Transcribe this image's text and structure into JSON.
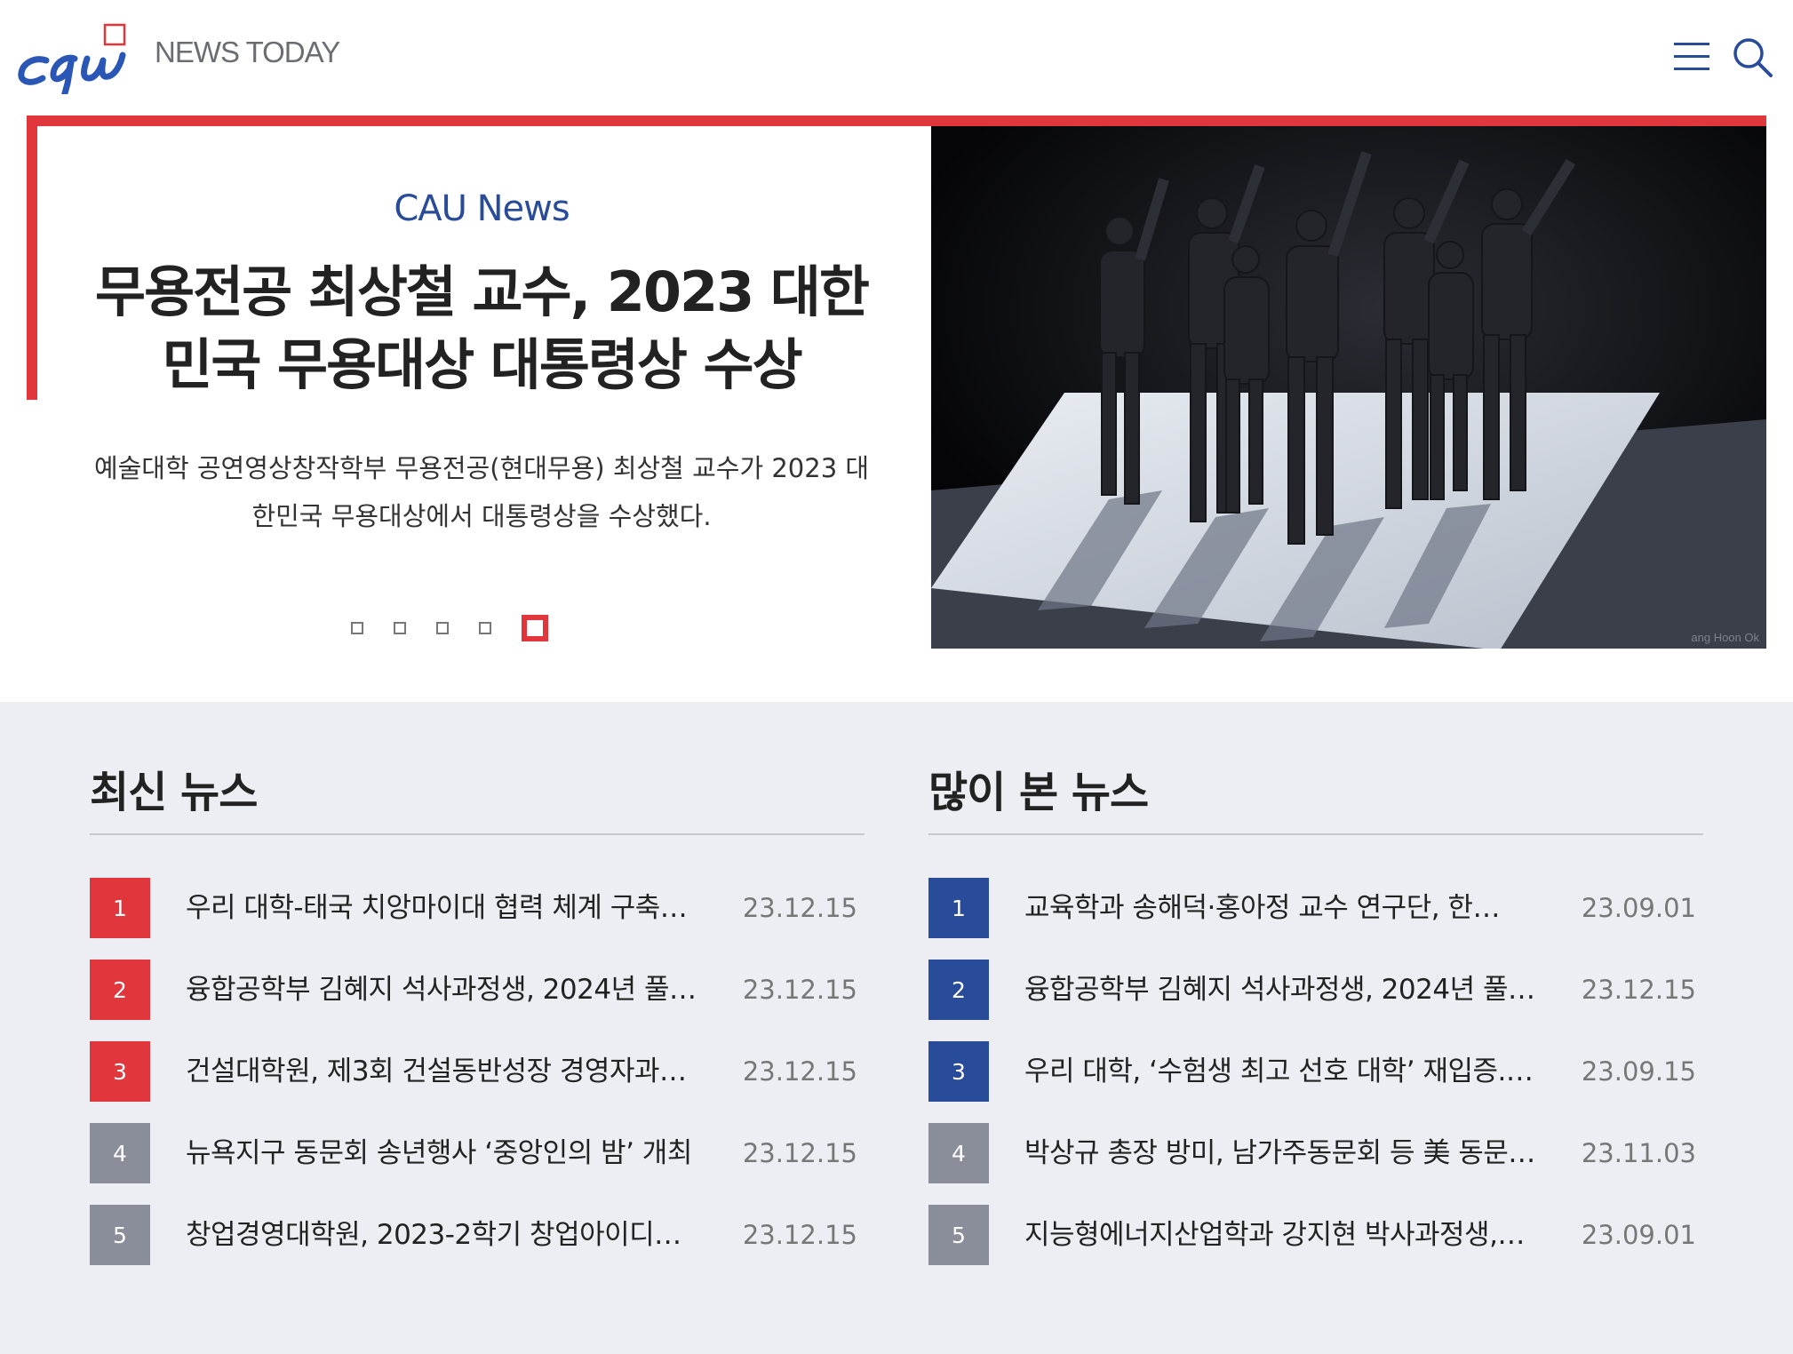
{
  "brand": {
    "logo_alt": "CAU",
    "name": "NEWS TODAY",
    "colors": {
      "red": "#e1363b",
      "blue": "#294c9a",
      "gray": "#8a8e9a"
    }
  },
  "header": {
    "menu_icon": "hamburger-menu-icon",
    "search_icon": "search-icon"
  },
  "hero": {
    "category": "CAU News",
    "title": "무용전공 최상철 교수, 2023 대한민국 무용대상 대통령상 수상",
    "summary": "예술대학 공연영상창작학부 무용전공(현대무용) 최상철 교수가 2023 대한민국 무용대상에서 대통령상을 수상했다.",
    "slide_count": 5,
    "active_slide": 5,
    "image_caption": "ang Hoon Ok"
  },
  "latest": {
    "heading": "최신 뉴스",
    "items": [
      {
        "rank": "1",
        "title": "우리 대학-태국 치앙마이대 협력 체계 구축…",
        "date": "23.12.15"
      },
      {
        "rank": "2",
        "title": "융합공학부 김혜지 석사과정생, 2024년 풀…",
        "date": "23.12.15"
      },
      {
        "rank": "3",
        "title": "건설대학원, 제3회 건설동반성장 경영자과…",
        "date": "23.12.15"
      },
      {
        "rank": "4",
        "title": "뉴욕지구 동문회 송년행사 ‘중앙인의 밤’ 개최",
        "date": "23.12.15"
      },
      {
        "rank": "5",
        "title": "창업경영대학원, 2023-2학기 창업아이디…",
        "date": "23.12.15"
      }
    ]
  },
  "popular": {
    "heading": "많이 본 뉴스",
    "items": [
      {
        "rank": "1",
        "title": "교육학과 송해덕·홍아정 교수 연구단, 한…",
        "date": "23.09.01"
      },
      {
        "rank": "2",
        "title": "융합공학부 김혜지 석사과정생, 2024년 풀…",
        "date": "23.12.15"
      },
      {
        "rank": "3",
        "title": "우리 대학, ‘수험생 최고 선호 대학’ 재입증.…",
        "date": "23.09.15"
      },
      {
        "rank": "4",
        "title": "박상규 총장 방미, 남가주동문회 등 美 동문…",
        "date": "23.11.03"
      },
      {
        "rank": "5",
        "title": "지능형에너지산업학과 강지현 박사과정생,…",
        "date": "23.09.01"
      }
    ]
  }
}
